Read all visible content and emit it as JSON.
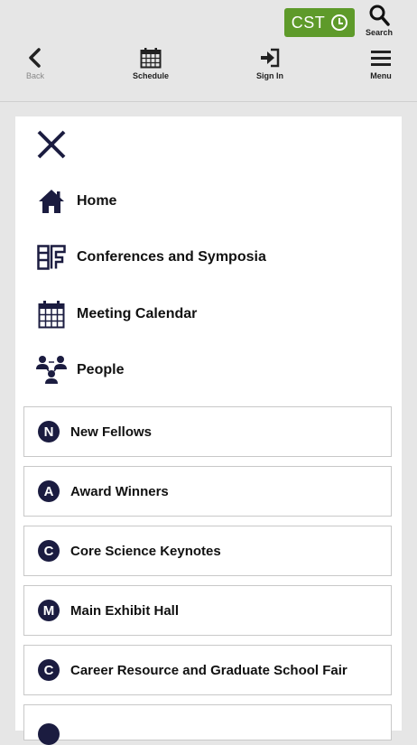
{
  "header": {
    "timezone_label": "CST",
    "search_label": "Search",
    "nav": [
      {
        "label": "Back",
        "icon": "chevron-left-icon"
      },
      {
        "label": "Schedule",
        "icon": "calendar-icon"
      },
      {
        "label": "Sign In",
        "icon": "sign-in-icon"
      },
      {
        "label": "Menu",
        "icon": "hamburger-icon"
      }
    ],
    "timezone_color": "#5e9a2a"
  },
  "menu": {
    "primary": [
      {
        "label": "Home",
        "icon": "home-icon"
      },
      {
        "label": "Conferences and Symposia",
        "icon": "conference-icon"
      },
      {
        "label": "Meeting Calendar",
        "icon": "calendar-icon"
      },
      {
        "label": "People",
        "icon": "people-icon"
      }
    ],
    "tiles": [
      {
        "badge": "N",
        "label": "New Fellows"
      },
      {
        "badge": "A",
        "label": "Award Winners"
      },
      {
        "badge": "C",
        "label": "Core Science Keynotes"
      },
      {
        "badge": "M",
        "label": "Main Exhibit Hall"
      },
      {
        "badge": "C",
        "label": "Career Resource and Graduate School Fair"
      }
    ],
    "accent_color": "#1b1c40"
  }
}
